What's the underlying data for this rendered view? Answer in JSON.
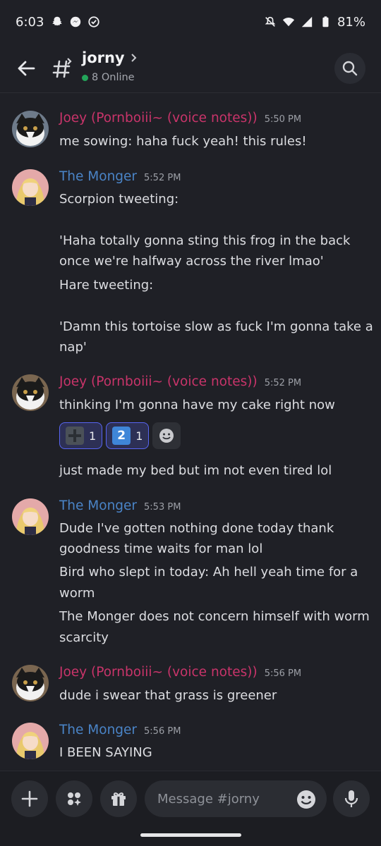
{
  "status_bar": {
    "time": "6:03",
    "battery": "81%"
  },
  "header": {
    "channel_name": "jorny",
    "online": "8 Online"
  },
  "messages": [
    {
      "author": "Joey (Pornboiii~ (voice notes))",
      "timestamp": "5:50 PM",
      "lines": [
        "me sowing: haha fuck yeah! this rules!"
      ]
    },
    {
      "author": "The Monger",
      "timestamp": "5:52 PM",
      "lines": [
        "Scorpion tweeting:",
        "'Haha totally gonna sting this frog in the back",
        "once we're halfway across the river lmao'",
        "Hare tweeting:",
        "'Damn this tortoise slow as fuck I'm gonna take a",
        "nap'"
      ]
    },
    {
      "author": "Joey (Pornboiii~ (voice notes))",
      "timestamp": "5:52 PM",
      "lines": [
        "thinking I'm gonna have my cake right now"
      ],
      "reactions": [
        {
          "emoji": "heavy-plus-sign",
          "count": "1"
        },
        {
          "emoji": "keycap-2",
          "glyph": "2",
          "count": "1"
        }
      ],
      "extra_line": "just made my bed but im not even tired lol"
    },
    {
      "author": "The Monger",
      "timestamp": "5:53 PM",
      "lines": [
        "Dude I've gotten nothing done today thank",
        "goodness time waits for man lol",
        "Bird who slept in today: Ah hell yeah time for a",
        "worm",
        "The Monger does not concern himself with worm",
        "scarcity"
      ]
    },
    {
      "author": "Joey (Pornboiii~ (voice notes))",
      "timestamp": "5:56 PM",
      "lines": [
        "dude i swear that grass is greener"
      ]
    },
    {
      "author": "The Monger",
      "timestamp": "5:56 PM",
      "lines": [
        "I BEEN SAYING"
      ]
    }
  ],
  "composer": {
    "placeholder": "Message #jorny"
  },
  "colors": {
    "background": "#1f2026",
    "joey_name": "#c9346a",
    "monger_name": "#4a84c7",
    "online_dot": "#23a55a",
    "reaction_border": "#5865f2"
  }
}
